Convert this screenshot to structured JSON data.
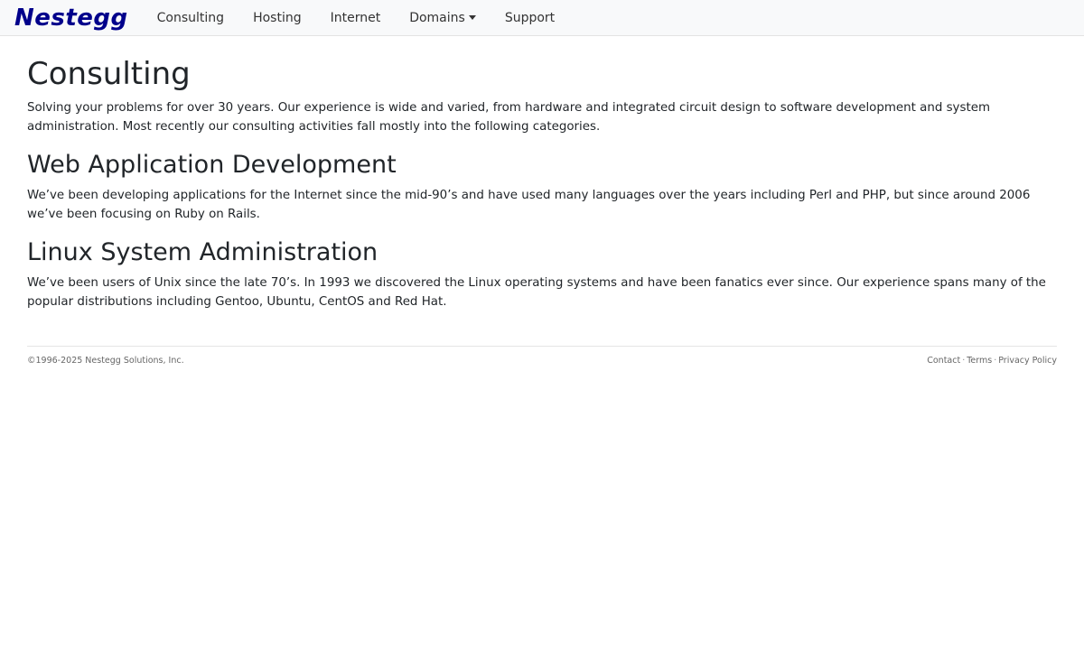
{
  "navbar": {
    "brand": "Nestegg",
    "items": [
      {
        "label": "Consulting"
      },
      {
        "label": "Hosting"
      },
      {
        "label": "Internet"
      },
      {
        "label": "Domains"
      },
      {
        "label": "Support"
      }
    ]
  },
  "main": {
    "title": "Consulting",
    "intro": "Solving your problems for over 30 years. Our experience is wide and varied, from hardware and integrated circuit design to software development and system administration. Most recently our consulting activities fall mostly into the following categories.",
    "sections": [
      {
        "heading": "Web Application Development",
        "body": "We’ve been developing applications for the Internet since the mid-90’s and have used many languages over the years including Perl and PHP, but since around 2006 we’ve been focusing on Ruby on Rails."
      },
      {
        "heading": "Linux System Administration",
        "body": "We’ve been users of Unix since the late 70’s. In 1993 we discovered the Linux operating systems and have been fanatics ever since. Our experience spans many of the popular distributions including Gentoo, Ubuntu, CentOS and Red Hat."
      }
    ]
  },
  "footer": {
    "copyright": "©1996-2025 Nestegg Solutions, Inc.",
    "links": [
      {
        "label": "Contact"
      },
      {
        "label": "Terms"
      },
      {
        "label": "Privacy Policy"
      }
    ],
    "separator": "·"
  },
  "colors": {
    "brand": "#00008b",
    "navbar_bg": "#f8f9fa",
    "text": "#212529",
    "footer_text": "#666666"
  },
  "icons": {
    "dropdown": "caret-down-icon"
  }
}
